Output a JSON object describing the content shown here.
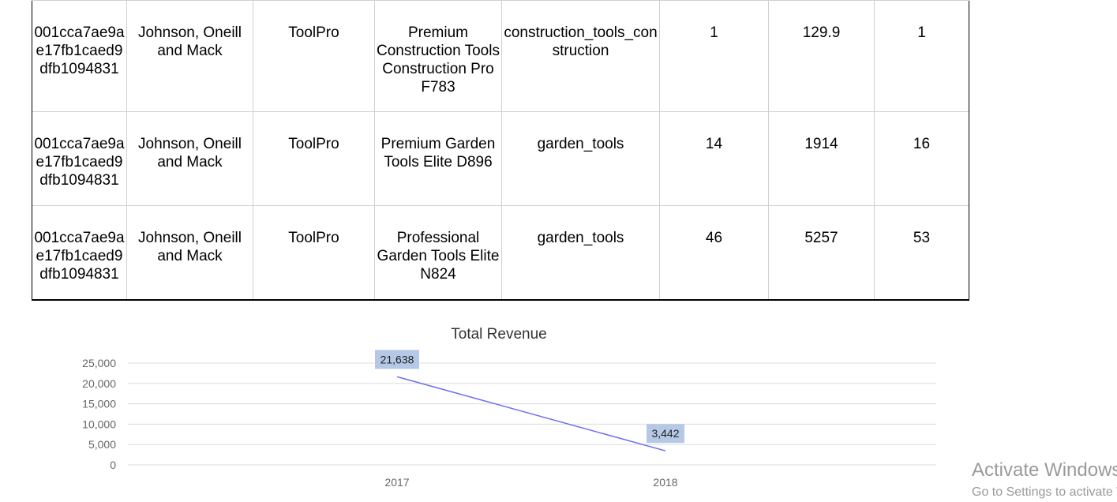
{
  "table": {
    "rows": [
      [
        "001cca7ae9ae17fb1caed9dfb1094831",
        "Johnson, Oneill and Mack",
        "ToolPro",
        "Premium Construction Tools Construction Pro F783",
        "construction_tools_construction",
        "1",
        "129.9",
        "1"
      ],
      [
        "001cca7ae9ae17fb1caed9dfb1094831",
        "Johnson, Oneill and Mack",
        "ToolPro",
        "Premium Garden Tools Elite D896",
        "garden_tools",
        "14",
        "1914",
        "16"
      ],
      [
        "001cca7ae9ae17fb1caed9dfb1094831",
        "Johnson, Oneill and Mack",
        "ToolPro",
        "Professional Garden Tools Elite N824",
        "garden_tools",
        "46",
        "5257",
        "53"
      ]
    ]
  },
  "chart_data": {
    "type": "line",
    "title": "Total Revenue",
    "categories": [
      "2017",
      "2018"
    ],
    "series": [
      {
        "values": [
          21638,
          3442
        ],
        "color": "#6b6ef0"
      }
    ],
    "data_labels": [
      "21,638",
      "3,442"
    ],
    "y_ticks": [
      "25,000",
      "20,000",
      "15,000",
      "10,000",
      "5,000",
      "0"
    ],
    "ylim": [
      0,
      25000
    ],
    "grid": true,
    "legend": "none",
    "label_bg": "#b5c9e6"
  },
  "watermark": {
    "line1": "Activate Windows",
    "line2": "Go to Settings to activate Windows."
  }
}
